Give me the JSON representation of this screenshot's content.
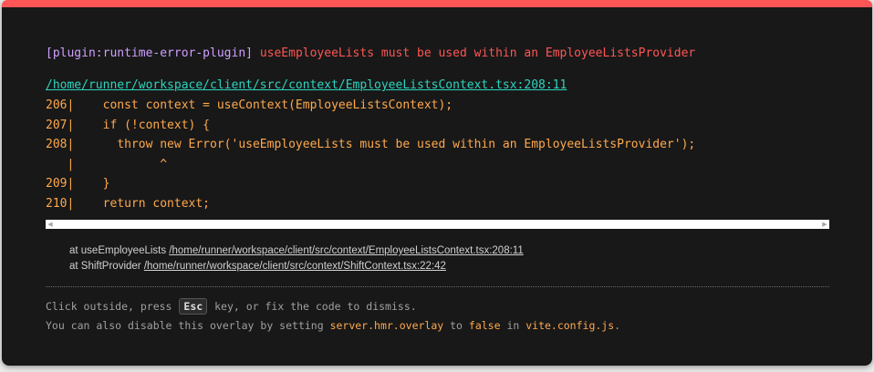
{
  "colors": {
    "accent_bar": "#ff5555",
    "background": "#181818",
    "plugin": "#cfa0ff",
    "message": "#ff5555",
    "file_link": "#2dd4bf",
    "code": "#ffa94d",
    "muted": "#a0a0a0"
  },
  "error": {
    "plugin": "[plugin:runtime-error-plugin]",
    "message": "useEmployeeLists must be used within an EmployeeListsProvider",
    "file": "/home/runner/workspace/client/src/context/EmployeeListsContext.tsx:208:11"
  },
  "frame": {
    "lines": [
      "206|    const context = useContext(EmployeeListsContext);",
      "207|    if (!context) {",
      "208|      throw new Error('useEmployeeLists must be used within an EmployeeListsProvider');",
      "   |            ^",
      "209|    }",
      "210|    return context;"
    ]
  },
  "stack": [
    {
      "prefix": "at useEmployeeLists ",
      "link": "/home/runner/workspace/client/src/context/EmployeeListsContext.tsx:208:11"
    },
    {
      "prefix": "at ShiftProvider ",
      "link": "/home/runner/workspace/client/src/context/ShiftContext.tsx:22:42"
    }
  ],
  "tips": {
    "line1_before": "Click outside, press ",
    "key": "Esc",
    "line1_after": " key, or fix the code to dismiss.",
    "line2_part1": "You can also disable this overlay by setting ",
    "line2_code1": "server.hmr.overlay",
    "line2_part2": " to ",
    "line2_code2": "false",
    "line2_part3": " in ",
    "line2_code3": "vite.config.js",
    "line2_part4": "."
  },
  "icons": {
    "scroll_left": "scroll-left-arrow-icon",
    "scroll_right": "scroll-right-arrow-icon"
  }
}
